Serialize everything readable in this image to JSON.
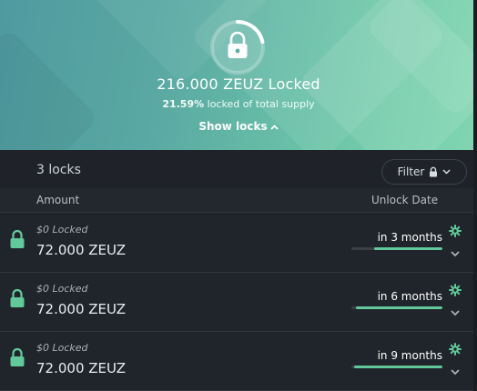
{
  "hero": {
    "title": "216.000 ZEUZ Locked",
    "percent_locked": "21.59%",
    "percent_suffix": "locked of total supply",
    "show_locks_label": "Show locks",
    "ring_fraction": 0.2159,
    "icon": "lock-icon"
  },
  "list_header": {
    "count_label": "3 locks",
    "filter_label": "Filter"
  },
  "columns": {
    "amount": "Amount",
    "unlock_date": "Unlock Date"
  },
  "locks": [
    {
      "locked_value": "$0 Locked",
      "amount": "72.000 ZEUZ",
      "unlock": "in 3 months",
      "progress": 0.75
    },
    {
      "locked_value": "$0 Locked",
      "amount": "72.000 ZEUZ",
      "unlock": "in 6 months",
      "progress": 0.95
    },
    {
      "locked_value": "$0 Locked",
      "amount": "72.000 ZEUZ",
      "unlock": "in 9 months",
      "progress": 0.97
    }
  ],
  "colors": {
    "accent": "#62c99a",
    "panel": "#20252b",
    "hero_start": "#4f9aa0",
    "hero_end": "#7fd6b0"
  }
}
